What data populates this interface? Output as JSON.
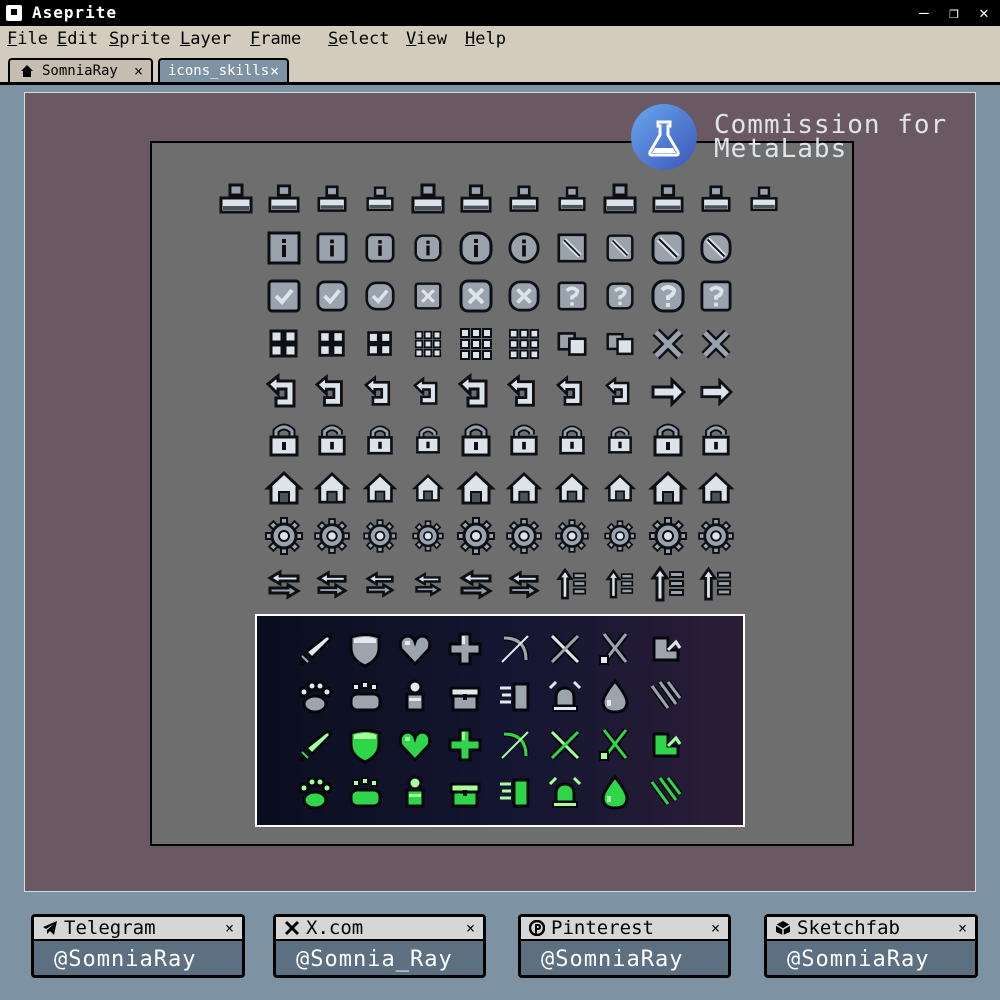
{
  "window": {
    "app_title": "Aseprite",
    "minimize": "–",
    "restore": "❐",
    "close": "✕"
  },
  "menu": [
    "File",
    "Edit",
    "Sprite",
    "Layer",
    "Frame",
    "Select",
    "View",
    "Help"
  ],
  "tabs": [
    {
      "label": "SomniaRay",
      "close": "×"
    },
    {
      "label": "icons_skills",
      "close": "×"
    }
  ],
  "watermark": {
    "line1": "Commission for",
    "line2": "MetaLabs"
  },
  "icon_rows": [
    {
      "name": "person",
      "count": 12
    },
    {
      "name": "info-and-forbidden",
      "count": 10
    },
    {
      "name": "check-x-question",
      "count": 10
    },
    {
      "name": "grid-and-swap",
      "count": 10
    },
    {
      "name": "back-arrow",
      "count": 10
    },
    {
      "name": "lock",
      "count": 10
    },
    {
      "name": "house",
      "count": 10
    },
    {
      "name": "gear",
      "count": 10
    },
    {
      "name": "sort-arrows",
      "count": 10
    }
  ],
  "skill_rows": [
    {
      "tone": "gray",
      "icons": [
        "sword",
        "shield",
        "heart",
        "plus",
        "bow",
        "crossed-swords",
        "crossed-blades",
        "boot"
      ]
    },
    {
      "tone": "gray",
      "icons": [
        "paw",
        "paw-wide",
        "knight",
        "chest",
        "dash",
        "alarm",
        "drop",
        "claws"
      ]
    },
    {
      "tone": "green",
      "icons": [
        "sword",
        "shield",
        "heart",
        "plus",
        "bow",
        "crossed-swords",
        "crossed-blades",
        "boot"
      ]
    },
    {
      "tone": "green",
      "icons": [
        "paw",
        "paw-wide",
        "knight",
        "chest",
        "dash",
        "alarm",
        "drop",
        "claws"
      ]
    }
  ],
  "social": [
    {
      "name": "Telegram",
      "handle": "@SomniaRay",
      "close": "×",
      "icon": "telegram-icon"
    },
    {
      "name": "X.com",
      "handle": "@Somnia_Ray",
      "close": "×",
      "icon": "x-icon"
    },
    {
      "name": "Pinterest",
      "handle": "@SomniaRay",
      "close": "×",
      "icon": "pinterest-icon"
    },
    {
      "name": "Sketchfab",
      "handle": "@SomniaRay",
      "close": "×",
      "icon": "sketchfab-icon"
    }
  ],
  "colors": {
    "workspace": "#7d93a4",
    "frame": "#6a5963",
    "canvas": "#6e6e6e",
    "icon_fill": "#9aa2ad",
    "icon_light": "#dde3ea",
    "skill_green": "#2fd64a"
  }
}
